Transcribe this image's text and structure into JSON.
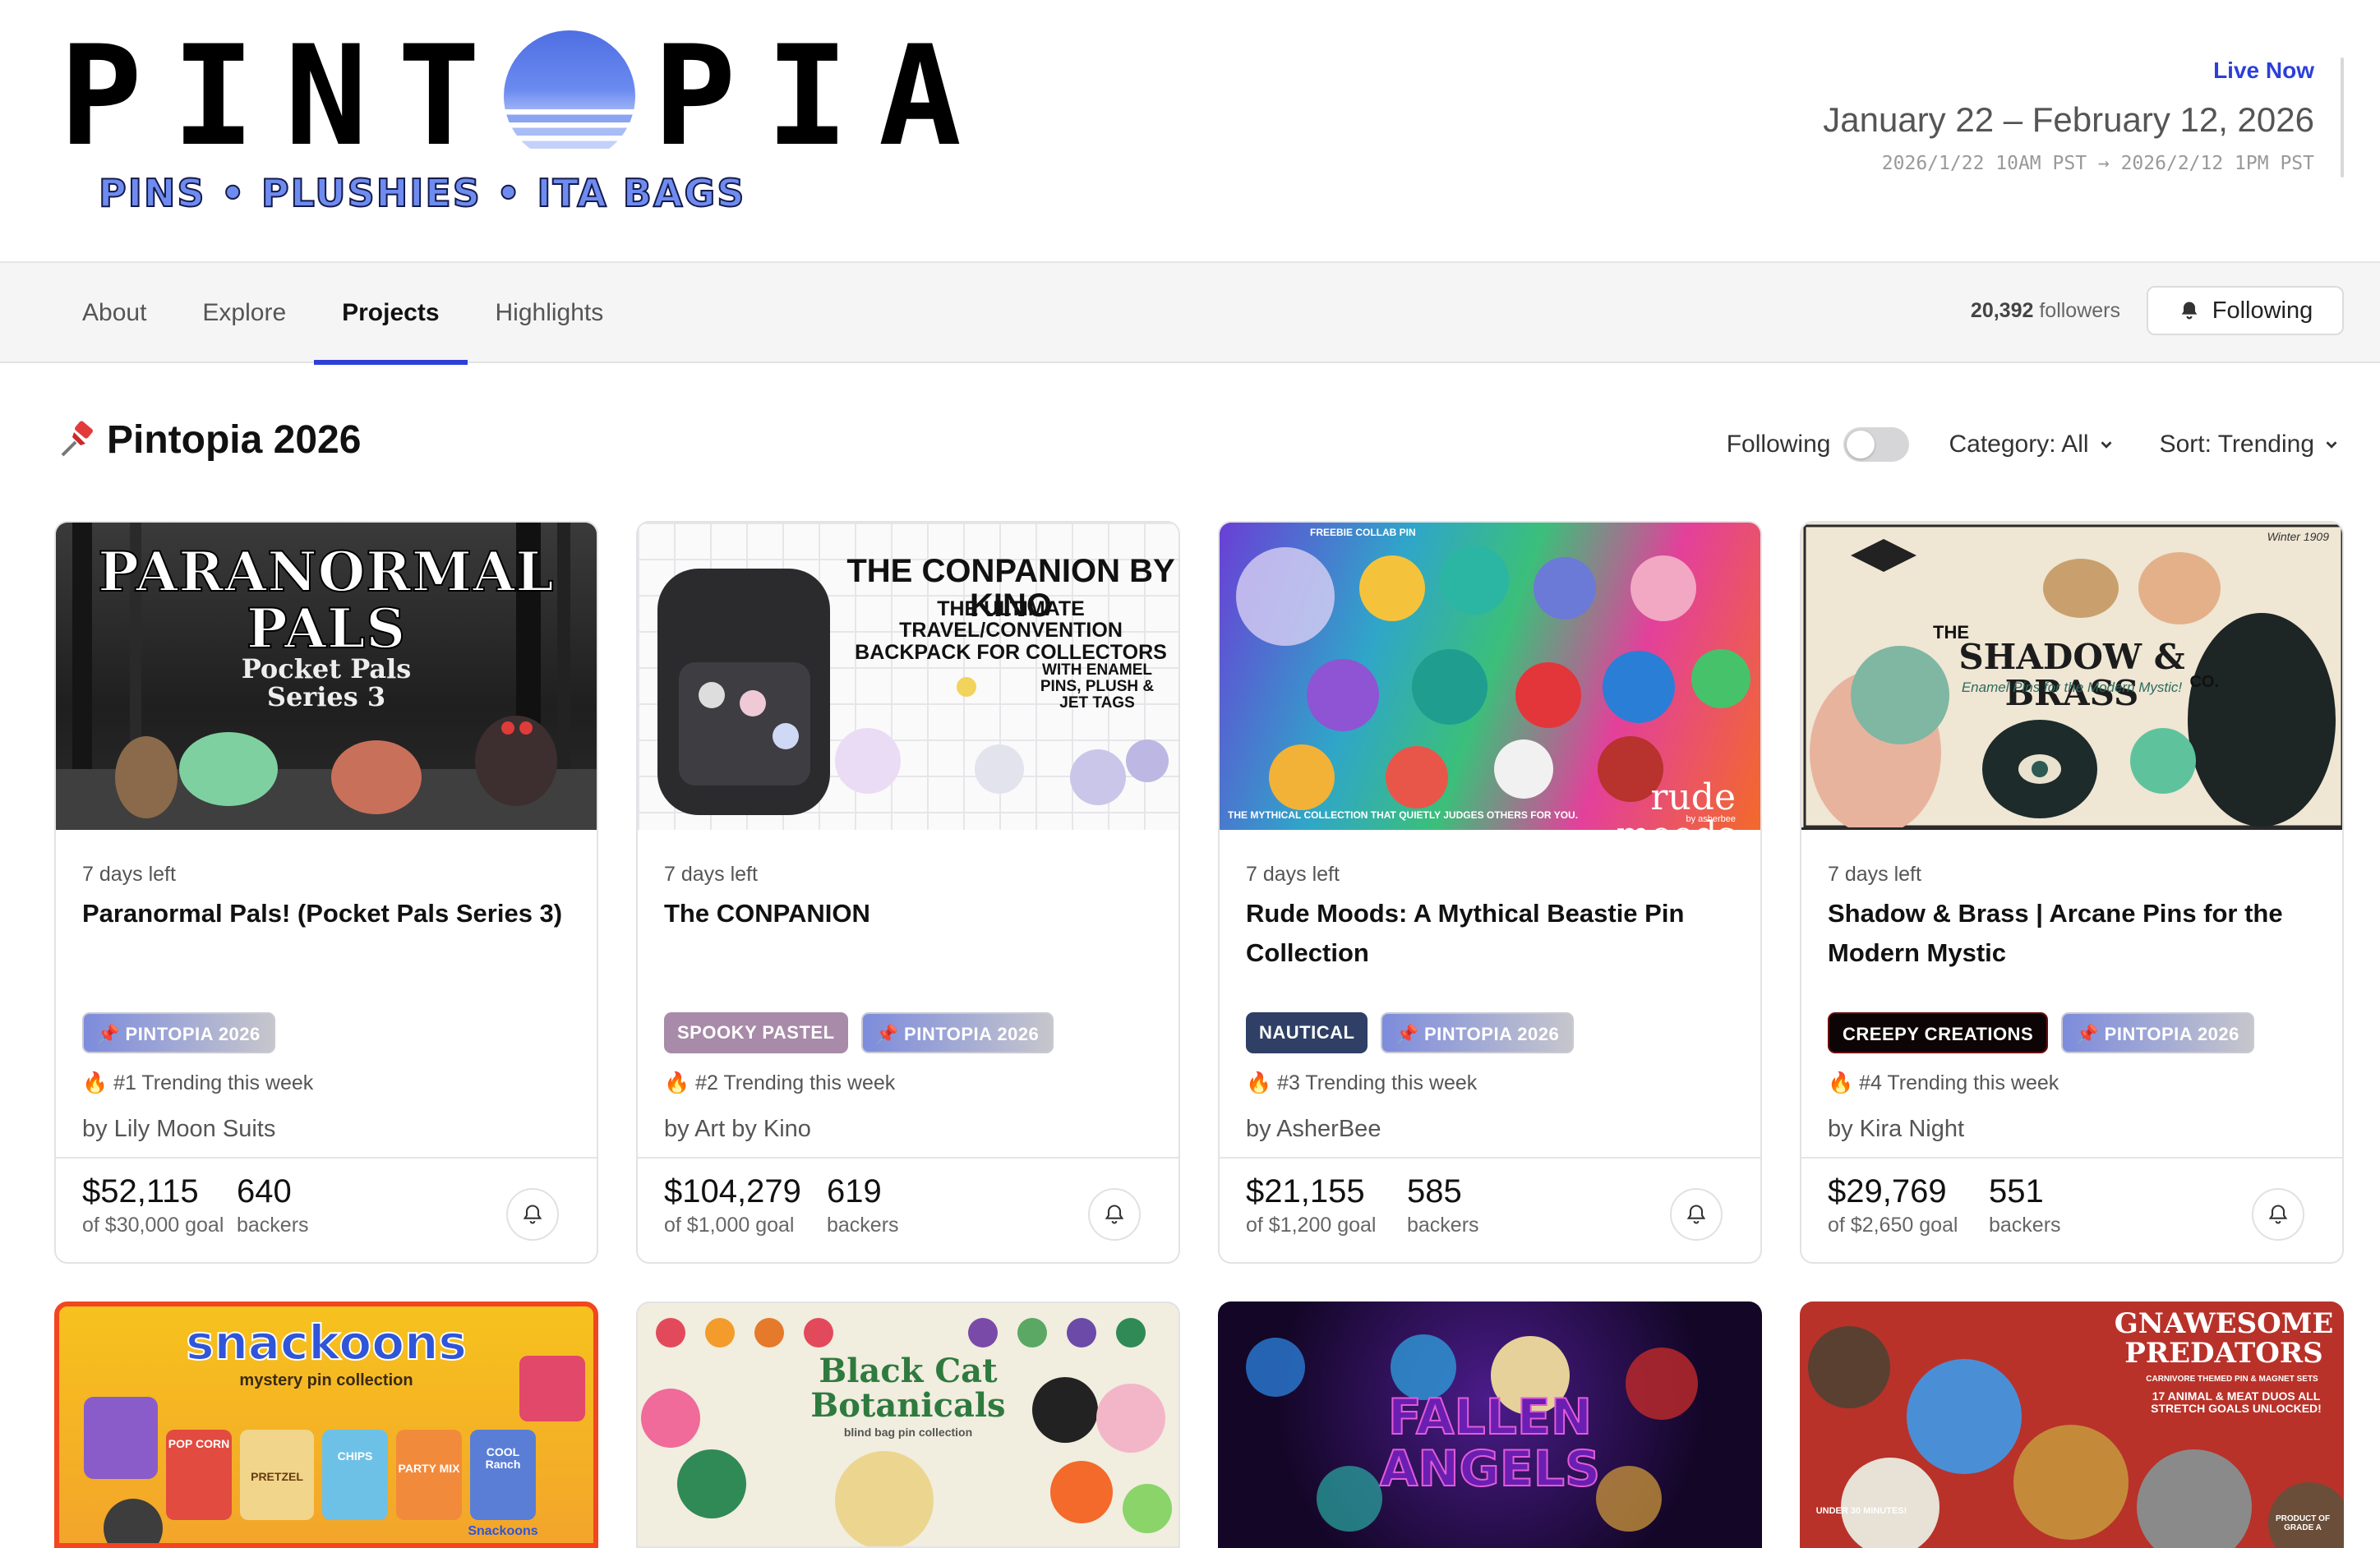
{
  "header": {
    "logo_letters_left": "PINT",
    "logo_letters_right": "PIA",
    "logo_tagline": "PINS • PLUSHIES • ITA BAGS",
    "live_label": "Live Now",
    "dates": "January 22 – February 12, 2026",
    "times": "2026/1/22 10AM PST → 2026/2/12 1PM PST"
  },
  "nav": {
    "tabs": [
      {
        "label": "About"
      },
      {
        "label": "Explore"
      },
      {
        "label": "Projects",
        "active": true
      },
      {
        "label": "Highlights"
      }
    ],
    "followers_count": "20,392",
    "followers_label": "followers",
    "following_button": "Following",
    "icons": {
      "bell": "bell-icon"
    }
  },
  "section": {
    "title": "Pintopia 2026",
    "emoji": "📌",
    "following_toggle_label": "Following",
    "following_toggle_on": false,
    "category": "Category: All",
    "sort": "Sort: Trending"
  },
  "colors": {
    "accent": "#2c3fd9",
    "tag_pin": "#7d8cdc",
    "tag_spooky": "#a88ba8",
    "tag_nautical": "#2f3f66",
    "tag_creepy": "#0d0505"
  },
  "cards": [
    {
      "thumb_title": "PARANORMAL PALS",
      "thumb_subtitle": "Pocket Pals Series 3",
      "days_left": "7 days left",
      "title": "Paranormal Pals! (Pocket Pals Series 3)",
      "tags": [
        {
          "label": "PINTOPIA 2026"
        }
      ],
      "trending": "#1 Trending this week",
      "creator": "by Lily Moon Suits",
      "pledged": "$52,115",
      "goal": "of $30,000 goal",
      "backers": "640",
      "backers_label": "backers"
    },
    {
      "thumb_title": "THE CONPANION BY KINO",
      "thumb_subtitle": "THE ULTIMATE TRAVEL/CONVENTION BACKPACK FOR COLLECTORS",
      "thumb_note": "WITH ENAMEL PINS, PLUSH & JET TAGS",
      "days_left": "7 days left",
      "title": "The CONPANION",
      "tags": [
        {
          "label": "SPOOKY PASTEL"
        },
        {
          "label": "PINTOPIA 2026"
        }
      ],
      "trending": "#2 Trending this week",
      "creator": "by Art by Kino",
      "pledged": "$104,279",
      "goal": "of $1,000 goal",
      "backers": "619",
      "backers_label": "backers"
    },
    {
      "thumb_title": "rude moods",
      "thumb_note": "THE MYTHICAL COLLECTION THAT QUIETLY JUDGES OTHERS FOR YOU.",
      "thumb_badge": "FREEBIE COLLAB PIN",
      "thumb_credit": "by asherbee",
      "days_left": "7 days left",
      "title": "Rude Moods: A Mythical Beastie Pin Collection",
      "tags": [
        {
          "label": "NAUTICAL"
        },
        {
          "label": "PINTOPIA 2026"
        }
      ],
      "trending": "#3 Trending this week",
      "creator": "by AsherBee",
      "pledged": "$21,155",
      "goal": "of $1,200 goal",
      "backers": "585",
      "backers_label": "backers"
    },
    {
      "thumb_title": "SHADOW & BRASS",
      "thumb_prefix": "THE",
      "thumb_suffix": "CO.",
      "thumb_subtitle": "Enamel Pins for the Modern Mystic!",
      "thumb_credit": "Winter 1909",
      "days_left": "7 days left",
      "title": "Shadow & Brass | Arcane Pins for the Modern Mystic",
      "tags": [
        {
          "label": "CREEPY CREATIONS"
        },
        {
          "label": "PINTOPIA 2026"
        }
      ],
      "trending": "#4 Trending this week",
      "creator": "by Kira Night",
      "pledged": "$29,769",
      "goal": "of $2,650 goal",
      "backers": "551",
      "backers_label": "backers"
    }
  ],
  "row2": [
    {
      "thumb_title": "snackoons",
      "thumb_subtitle": "mystery pin collection",
      "thumb_labels": [
        "POP CORN",
        "PRETZEL",
        "CHIPS",
        "PARTY MIX",
        "COOL Ranch",
        "Snackoons"
      ]
    },
    {
      "thumb_title": "Black Cat Botanicals",
      "thumb_subtitle": "blind bag pin collection"
    },
    {
      "thumb_title": "FALLEN ANGELS"
    },
    {
      "thumb_title": "GNAWESOME PREDATORS",
      "thumb_subtitle": "CARNIVORE THEMED PIN & MAGNET SETS",
      "thumb_note": "17 ANIMAL & MEAT DUOS ALL STRETCH GOALS UNLOCKED!",
      "thumb_labels": [
        "UNDER 30 MINUTES!",
        "PRODUCT OF GRADE A"
      ]
    }
  ]
}
